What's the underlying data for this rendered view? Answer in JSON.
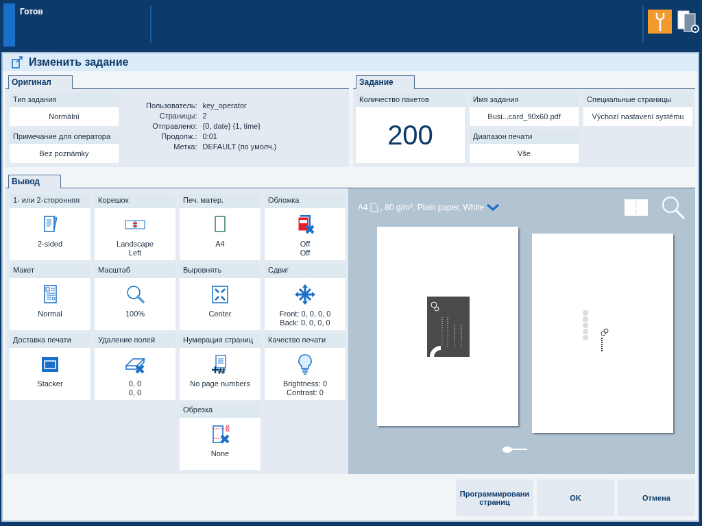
{
  "status": "Готов",
  "dialog": {
    "title": "Изменить задание"
  },
  "original": {
    "tab": "Оригинал",
    "fields": [
      {
        "label": "Тип задания",
        "value": "Normální"
      },
      {
        "label": "Примечание для оператора",
        "value": "Bez poznámky"
      }
    ],
    "info": [
      {
        "key": "Пользователь:",
        "value": "key_operator"
      },
      {
        "key": "Страницы:",
        "value": "2"
      },
      {
        "key": "Отправлено:",
        "value": "{0, date} {1, time}"
      },
      {
        "key": "Продолж.:",
        "value": "0:01"
      },
      {
        "key": "Метка:",
        "value": "DEFAULT (по умолч.)"
      }
    ]
  },
  "job": {
    "tab": "Задание",
    "copies": {
      "label": "Количество пакетов",
      "value": "200"
    },
    "name": {
      "label": "Имя задания",
      "value": "Busi...card_90x60.pdf"
    },
    "range": {
      "label": "Диапазон печати",
      "value": "Vše"
    },
    "special": {
      "label": "Специальные страницы",
      "value": "Výchozí nastavení systému"
    }
  },
  "output": {
    "tab": "Вывод",
    "tiles": [
      {
        "label": "1- или 2-сторонняя",
        "lines": [
          "2-sided"
        ]
      },
      {
        "label": "Корешок",
        "lines": [
          "Landscape",
          "Left"
        ]
      },
      {
        "label": "Печ. матер.",
        "lines": [
          "A4"
        ]
      },
      {
        "label": "Обложка",
        "lines": [
          "Off",
          "Off"
        ]
      },
      {
        "label": "Макет",
        "lines": [
          "Normal"
        ]
      },
      {
        "label": "Масштаб",
        "lines": [
          "100%"
        ]
      },
      {
        "label": "Выровнять",
        "lines": [
          "Center"
        ]
      },
      {
        "label": "Сдвиг",
        "lines": [
          "Front: 0, 0, 0, 0",
          "Back: 0, 0, 0, 0"
        ]
      },
      {
        "label": "Доставка печати",
        "lines": [
          "Stacker"
        ]
      },
      {
        "label": "Удаление полей",
        "lines": [
          "0, 0",
          "0, 0"
        ]
      },
      {
        "label": "Нумерация страниц",
        "lines": [
          "No page numbers"
        ]
      },
      {
        "label": "Качество печати",
        "lines": [
          "Brightness: 0",
          "Contrast: 0"
        ]
      },
      {
        "label": "Обрезка",
        "lines": [
          "None"
        ]
      }
    ]
  },
  "preview": {
    "media_size": "A4",
    "media_details": ", 80 g/m², Plain paper, White",
    "page_slider": {
      "level": 0
    }
  },
  "buttons": [
    "Программировани страниц",
    "OK",
    "Отмена"
  ]
}
